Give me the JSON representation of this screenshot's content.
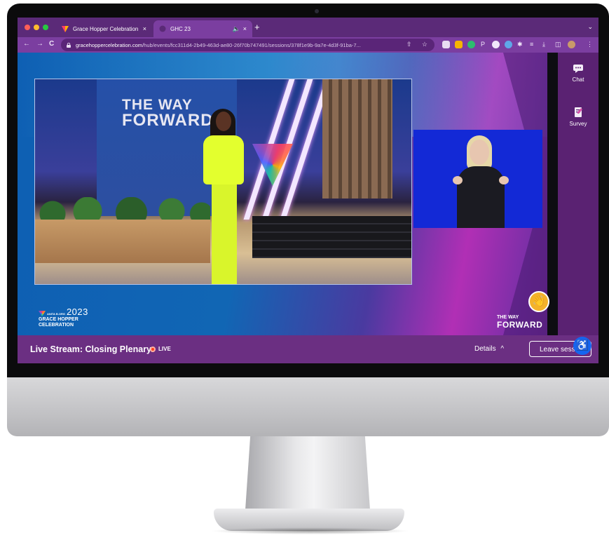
{
  "browser": {
    "tabs": [
      {
        "label": "Grace Hopper Celebration 20…",
        "close": "×"
      },
      {
        "label": "GHC 23",
        "close": "×",
        "audio": "🔈"
      }
    ],
    "new_tab": "+",
    "tab_menu": "⌄",
    "nav": {
      "back": "←",
      "forward": "→",
      "reload": "C"
    },
    "url_host": "gracehoppercelebration.com",
    "url_path": "/hub/events/fcc311d4-2b49-463d-ae80-26f70b747491/sessions/378f1e9b-9a7e-4d3f-91ba-7...",
    "omni_icons": "⇧ ☆",
    "toolbar_glyphs": [
      "P",
      "✱",
      "≡",
      "⤓",
      "◫",
      "⋮"
    ]
  },
  "stage": {
    "banner_line1": "THE WAY",
    "banner_line2": "FORWARD"
  },
  "sidebar": {
    "items": [
      {
        "label": "Chat",
        "icon": "chat-icon"
      },
      {
        "label": "Survey",
        "icon": "survey-icon"
      }
    ]
  },
  "branding": {
    "ghc_small": "ANITA B.ORG",
    "ghc_year": "2023",
    "ghc_line1": "GRACE HOPPER",
    "ghc_line2": "CELEBRATION",
    "twf_line1": "THE WAY",
    "twf_line2": "FORWARD"
  },
  "footer": {
    "session_title": "Live Stream: Closing Plenary",
    "live_label": "LIVE",
    "details_label": "Details",
    "details_chevron": "^",
    "leave_label": "Leave session"
  },
  "icons": {
    "wave": "👋",
    "accessibility": "♿"
  },
  "colors": {
    "accent_purple": "#6b2f82",
    "live_red": "#ff3d1a",
    "a11y_blue": "#1565f0"
  }
}
